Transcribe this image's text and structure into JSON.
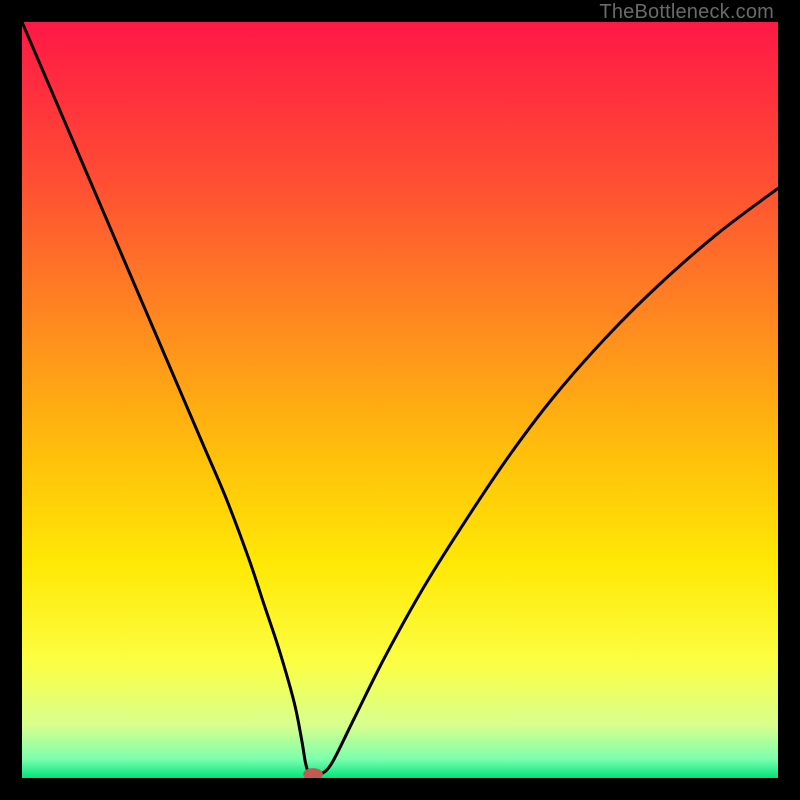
{
  "watermark": "TheBottleneck.com",
  "chart_data": {
    "type": "line",
    "title": "",
    "xlabel": "",
    "ylabel": "",
    "xlim": [
      0,
      100
    ],
    "ylim": [
      0,
      100
    ],
    "grid": false,
    "legend": false,
    "background_gradient_stops": [
      {
        "offset": 0.0,
        "color": "#ff1846"
      },
      {
        "offset": 0.2,
        "color": "#ff4b34"
      },
      {
        "offset": 0.4,
        "color": "#ff8a1f"
      },
      {
        "offset": 0.58,
        "color": "#ffc20a"
      },
      {
        "offset": 0.72,
        "color": "#ffe906"
      },
      {
        "offset": 0.85,
        "color": "#fbff45"
      },
      {
        "offset": 0.93,
        "color": "#d8ff8d"
      },
      {
        "offset": 0.975,
        "color": "#7bffad"
      },
      {
        "offset": 1.0,
        "color": "#00e57b"
      }
    ],
    "series": [
      {
        "name": "bottleneck-curve",
        "color": "#000000",
        "x": [
          0,
          3,
          6,
          9,
          12,
          15,
          18,
          21,
          24,
          27,
          30,
          32,
          34,
          36,
          37,
          37.5,
          38,
          38.7,
          39.5,
          41,
          44,
          48,
          53,
          58,
          64,
          70,
          77,
          84,
          92,
          100
        ],
        "y": [
          100,
          93,
          86,
          79,
          72,
          65,
          58,
          51,
          44,
          37,
          29,
          23,
          17,
          10,
          5,
          2,
          0.5,
          0.5,
          0.5,
          2,
          8,
          16,
          25,
          33,
          42,
          50,
          58,
          65,
          72,
          78
        ]
      }
    ],
    "marker": {
      "name": "optimal-point",
      "x": 38.5,
      "y": 0.5,
      "rx": 1.3,
      "ry": 0.8,
      "color": "#c15a55"
    }
  }
}
